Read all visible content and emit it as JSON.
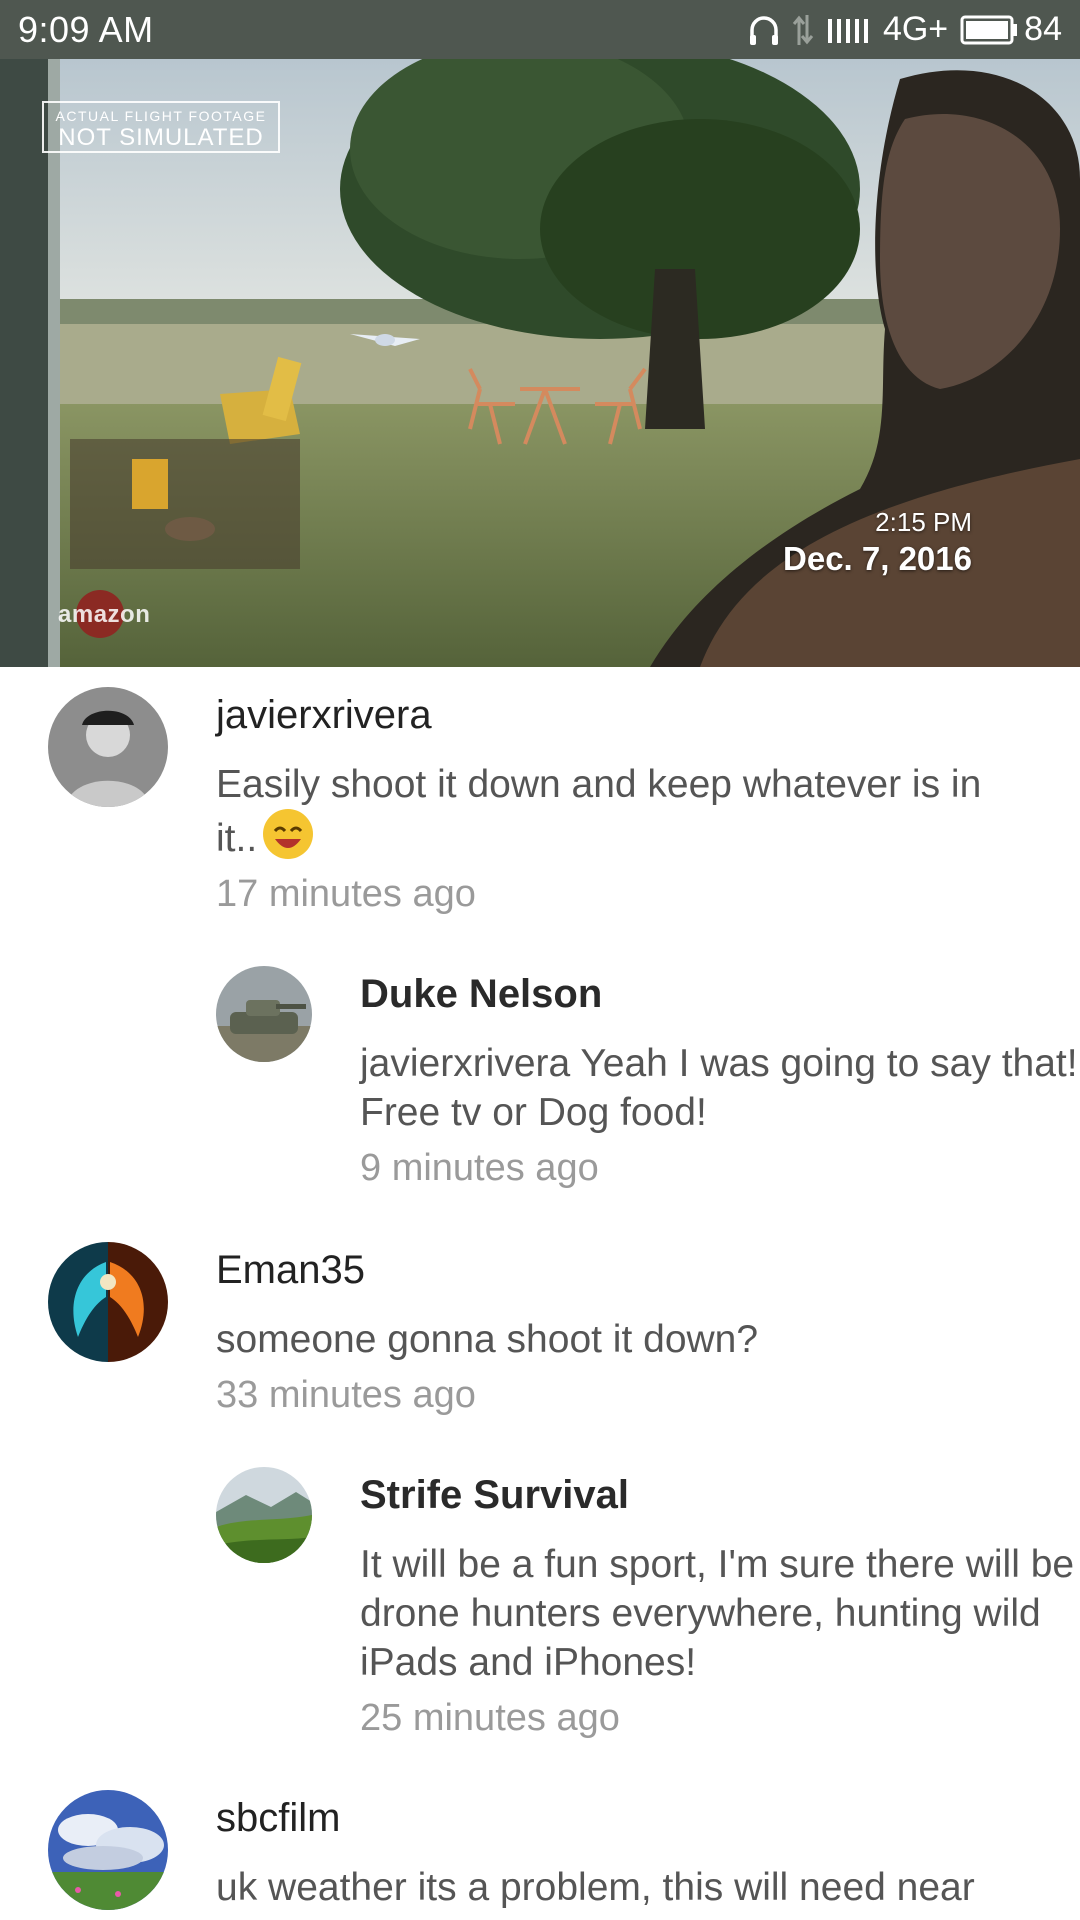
{
  "status_bar": {
    "time": "9:09  AM",
    "network": "4G+",
    "battery": "84",
    "icons": [
      "headphones-icon",
      "data-arrows-icon",
      "signal-icon",
      "battery-icon"
    ]
  },
  "video": {
    "badge_line1": "ACTUAL FLIGHT FOOTAGE",
    "badge_line2": "NOT SIMULATED",
    "time": "2:15 PM",
    "date": "Dec. 7, 2016",
    "brand": "amazon"
  },
  "comments": [
    {
      "author": "javierxrivera",
      "text": "Easily shoot it down and keep whatever is in it..",
      "emoji": "smiling-face-emoji",
      "time": "17 minutes ago",
      "replies": [
        {
          "author": "Duke Nelson",
          "text": "javierxrivera Yeah I was going to say that! Free tv or Dog food!",
          "time": "9 minutes ago"
        }
      ]
    },
    {
      "author": "Eman35",
      "text": "someone gonna shoot it down?",
      "time": "33 minutes ago",
      "replies": [
        {
          "author": "Strife Survival",
          "text": "It will be a fun sport, I'm sure there will be drone hunters everywhere, hunting wild iPads and iPhones!",
          "time": "25 minutes ago"
        }
      ]
    },
    {
      "author": "sbcfilm",
      "text": "uk weather its a problem, this will need near perfect flight conditions, also around here",
      "time": ""
    }
  ]
}
